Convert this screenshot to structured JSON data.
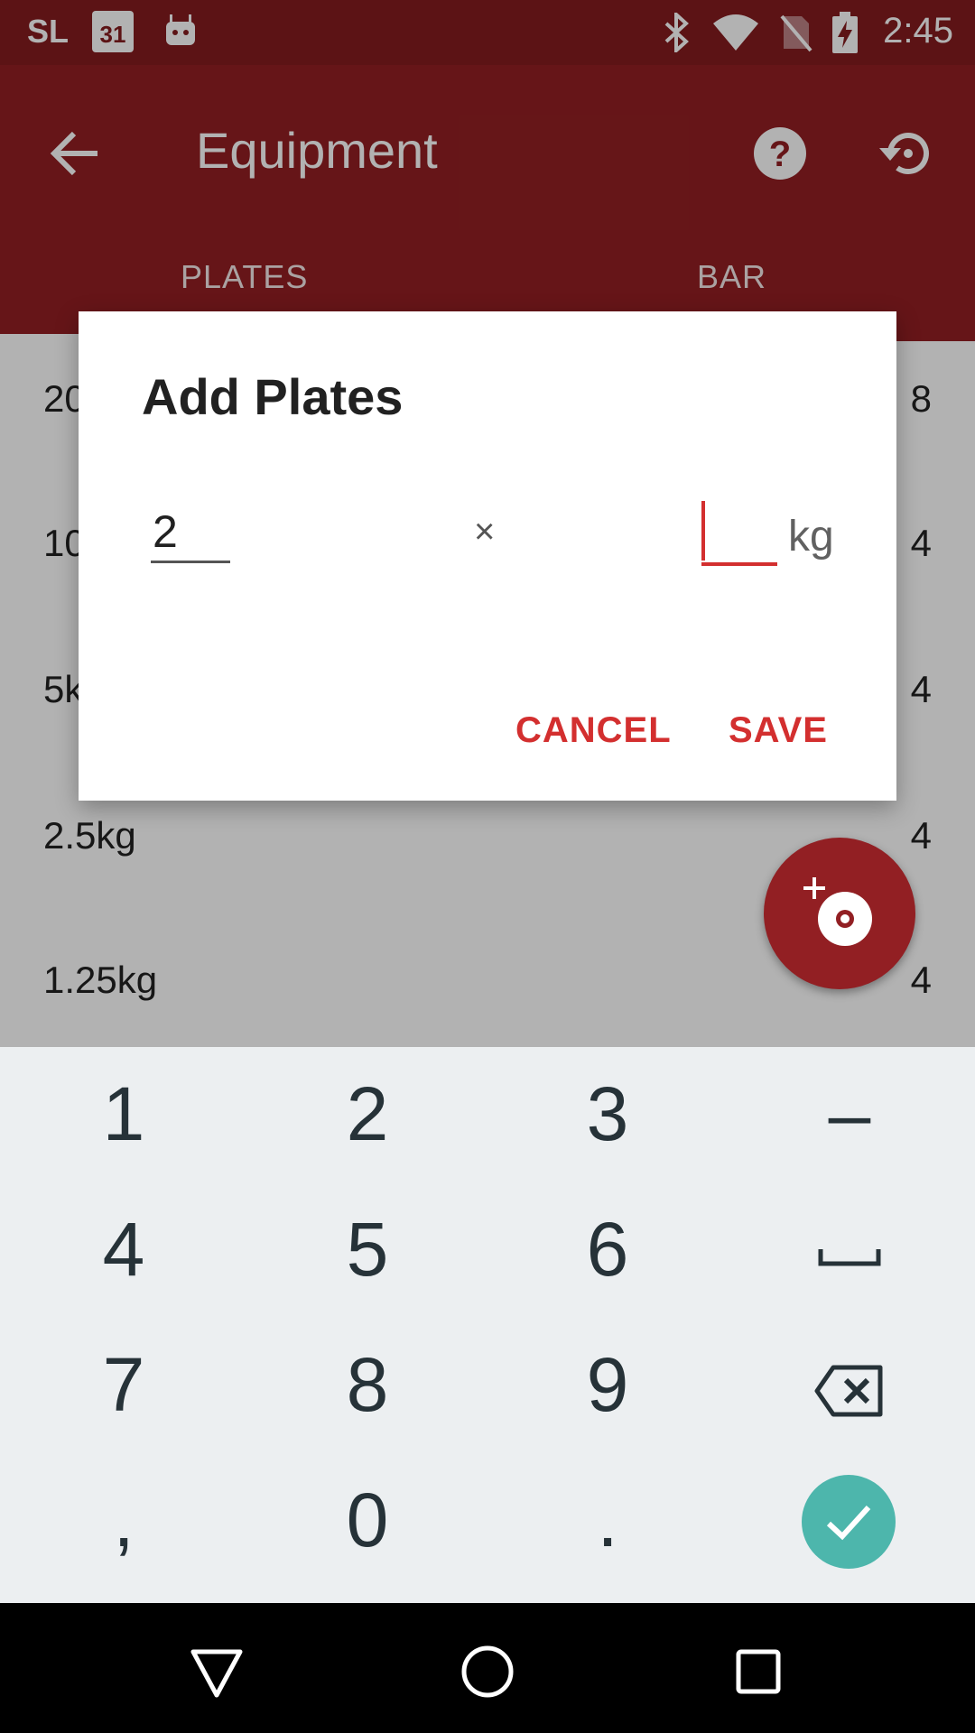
{
  "status_bar": {
    "carrier": "SL",
    "calendar_day": "31",
    "time": "2:45",
    "icons": [
      "calendar-icon",
      "android-icon",
      "bluetooth-icon",
      "wifi-icon",
      "no-sim-icon",
      "battery-charging-icon"
    ]
  },
  "app_bar": {
    "title": "Equipment",
    "back_icon": "arrow-back-icon",
    "help_icon": "help-icon",
    "history_icon": "restore-icon",
    "tabs": [
      {
        "label": "PLATES",
        "selected": true
      },
      {
        "label": "BAR",
        "selected": false
      }
    ]
  },
  "plates_list": [
    {
      "weight": "20",
      "count": "8"
    },
    {
      "weight": "10",
      "count": "4"
    },
    {
      "weight": "5k",
      "count": "4"
    },
    {
      "weight": "2.5kg",
      "count": "4"
    },
    {
      "weight": "1.25kg",
      "count": "4"
    }
  ],
  "dialog": {
    "title": "Add Plates",
    "count_value": "2",
    "multiply_symbol": "×",
    "weight_value": "",
    "unit": "kg",
    "cancel_label": "CANCEL",
    "save_label": "SAVE"
  },
  "fab": {
    "icon": "add-plate-icon"
  },
  "keyboard": {
    "rows": [
      [
        "1",
        "2",
        "3",
        "–"
      ],
      [
        "4",
        "5",
        "6",
        "␣"
      ],
      [
        "7",
        "8",
        "9",
        "⌫"
      ],
      [
        ",",
        "0",
        ".",
        "✓"
      ]
    ]
  },
  "colors": {
    "app_bar": "#921f23",
    "status_bar": "#851c1f",
    "accent": "#d32f2f",
    "enter_key": "#4db6ac",
    "keyboard_bg": "#eceff1"
  },
  "nav_bar": {
    "icons": [
      "back-triangle-icon",
      "home-circle-icon",
      "recents-square-icon"
    ]
  }
}
